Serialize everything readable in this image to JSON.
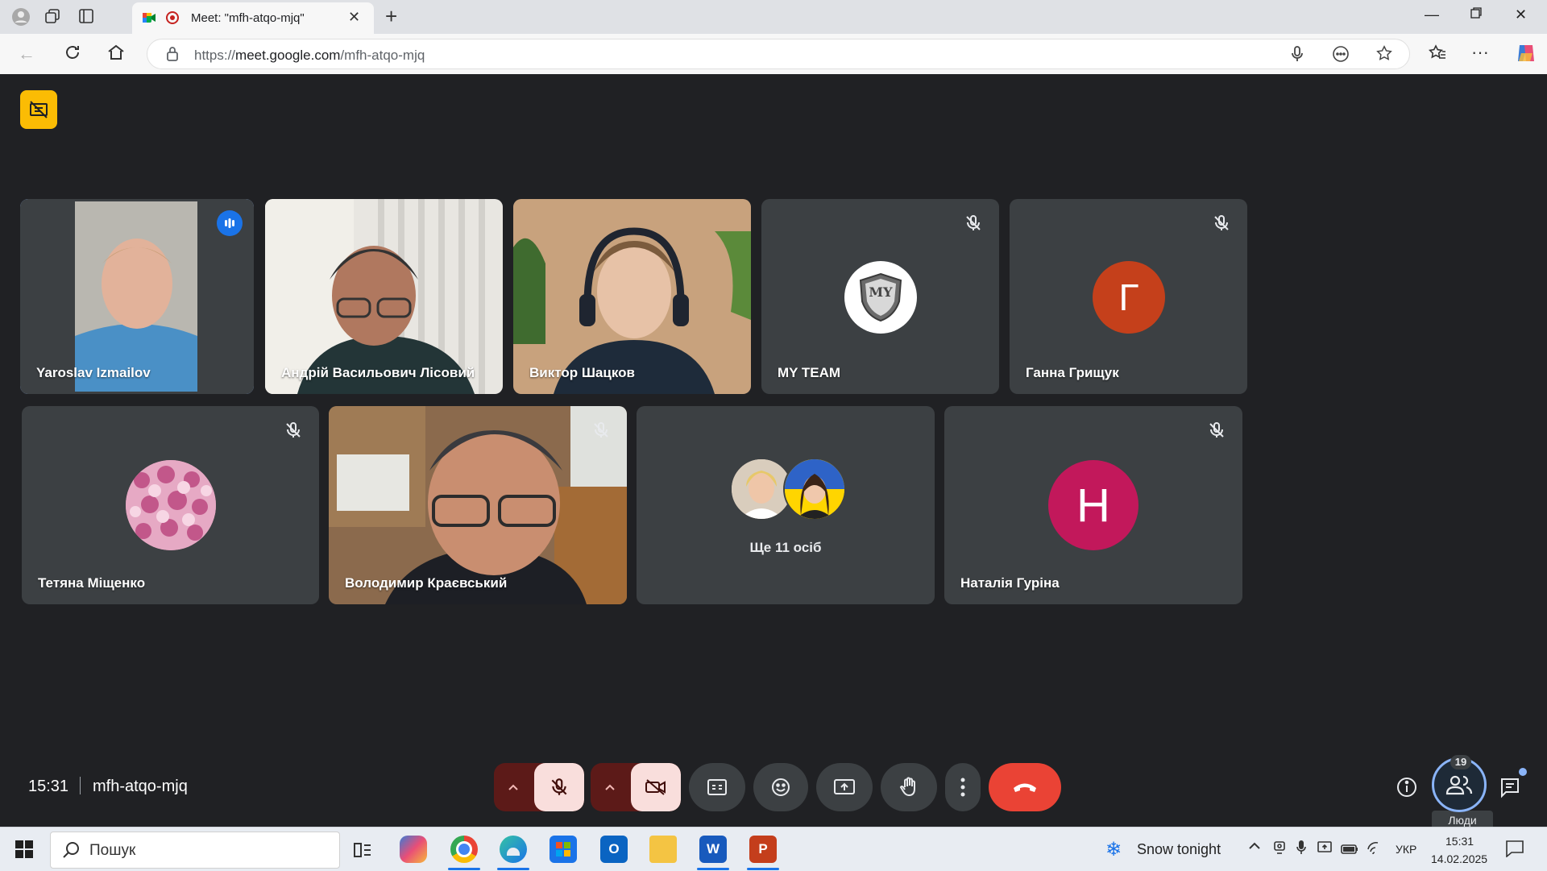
{
  "browser": {
    "tab_title": "Meet: \"mfh-atqo-mjq\"",
    "url_prefix": "https://",
    "url_host": "meet.google.com",
    "url_path": "/mfh-atqo-mjq"
  },
  "participants_row1": [
    {
      "name": "Yaroslav Izmailov",
      "state": "speaking"
    },
    {
      "name": "Андрій Васильович Лісовий",
      "state": "video"
    },
    {
      "name": "Виктор Шацков",
      "state": "video"
    },
    {
      "name": "MY TEAM",
      "state": "muted",
      "avatar_text": "MY"
    },
    {
      "name": "Ганна Грищук",
      "state": "muted",
      "avatar_letter": "Г",
      "avatar_color": "#c5401b"
    }
  ],
  "participants_row2": [
    {
      "name": "Тетяна Міщенко",
      "state": "muted"
    },
    {
      "name": "Володимир Краєвський",
      "state": "muted"
    },
    {
      "name": "Наталія Гуріна",
      "state": "muted",
      "avatar_letter": "Н",
      "avatar_color": "#c2185b"
    }
  ],
  "others": {
    "label": "Ще 11 осіб"
  },
  "controls": {
    "clock": "15:31",
    "meeting_code": "mfh-atqo-mjq",
    "people_tooltip": "Люди",
    "people_count": "19",
    "end_call_color": "#ea4335"
  },
  "taskbar": {
    "search_placeholder": "Пошук",
    "weather": "Snow tonight",
    "lang": "УКР",
    "time": "15:31",
    "date": "14.02.2025"
  }
}
